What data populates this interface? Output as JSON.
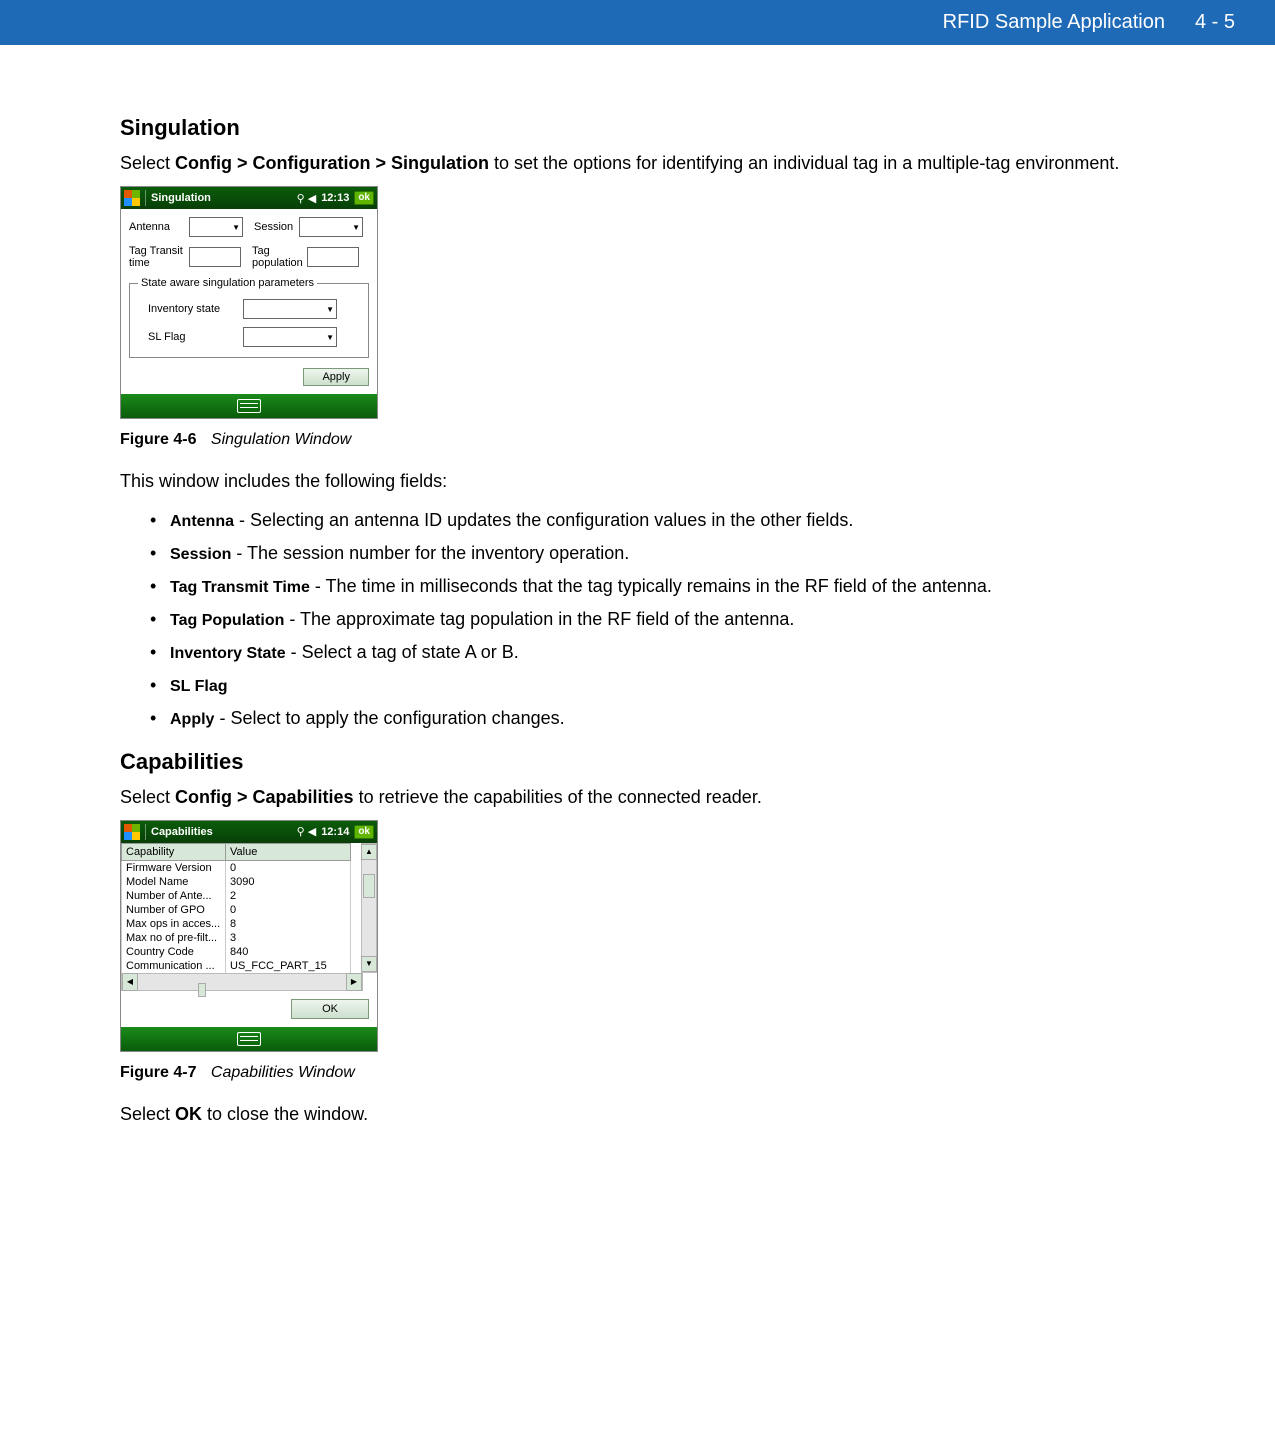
{
  "header": {
    "title": "RFID Sample Application",
    "page": "4 - 5"
  },
  "sections": {
    "singulation": {
      "heading": "Singulation",
      "intro_pre": "Select ",
      "intro_bold": "Config > Configuration > Singulation",
      "intro_post": " to set the options for identifying an individual tag in a multiple-tag environment.",
      "figure": {
        "num": "Figure 4-6",
        "title": "Singulation Window"
      },
      "fields_intro": "This window includes the following fields:",
      "bullets": [
        {
          "term": "Antenna",
          "desc": " - Selecting an antenna ID updates the configuration values in the other fields."
        },
        {
          "term": "Session",
          "desc": " - The session number for the inventory operation."
        },
        {
          "term": "Tag Transmit Time",
          "desc": " - The time in milliseconds that the tag typically remains in the RF field of the antenna."
        },
        {
          "term": "Tag Population",
          "desc": " - The approximate tag population in the RF field of the antenna."
        },
        {
          "term": "Inventory State",
          "desc": " - Select a tag of state A or B."
        },
        {
          "term": "SL Flag",
          "desc": ""
        },
        {
          "term": "Apply",
          "desc": " - Select to apply the configuration changes."
        }
      ]
    },
    "capabilities": {
      "heading": "Capabilities",
      "intro_pre": "Select ",
      "intro_bold": "Config > Capabilities",
      "intro_post": " to retrieve the capabilities of the connected reader.",
      "figure": {
        "num": "Figure 4-7",
        "title": "Capabilities Window"
      },
      "footer_pre": "Select ",
      "footer_bold": "OK",
      "footer_post": " to close the window."
    }
  },
  "device1": {
    "title": "Singulation",
    "time": "12:13",
    "ok": "ok",
    "labels": {
      "antenna": "Antenna",
      "session": "Session",
      "tag_transit": "Tag Transit time",
      "tag_pop": "Tag population",
      "fieldset": "State aware singulation parameters",
      "inv_state": "Inventory state",
      "sl_flag": "SL Flag",
      "apply": "Apply"
    }
  },
  "device2": {
    "title": "Capabilities",
    "time": "12:14",
    "ok": "ok",
    "headers": {
      "cap": "Capability",
      "val": "Value"
    },
    "rows": [
      {
        "cap": "Firmware Version",
        "val": "0"
      },
      {
        "cap": "Model Name",
        "val": "3090"
      },
      {
        "cap": "Number of Ante...",
        "val": "2"
      },
      {
        "cap": "Number of GPO",
        "val": "0"
      },
      {
        "cap": "Max ops in acces...",
        "val": "8"
      },
      {
        "cap": "Max no of pre-filt...",
        "val": "3"
      },
      {
        "cap": "Country Code",
        "val": "840"
      },
      {
        "cap": "Communication ...",
        "val": "US_FCC_PART_15"
      }
    ],
    "ok_button": "OK"
  }
}
